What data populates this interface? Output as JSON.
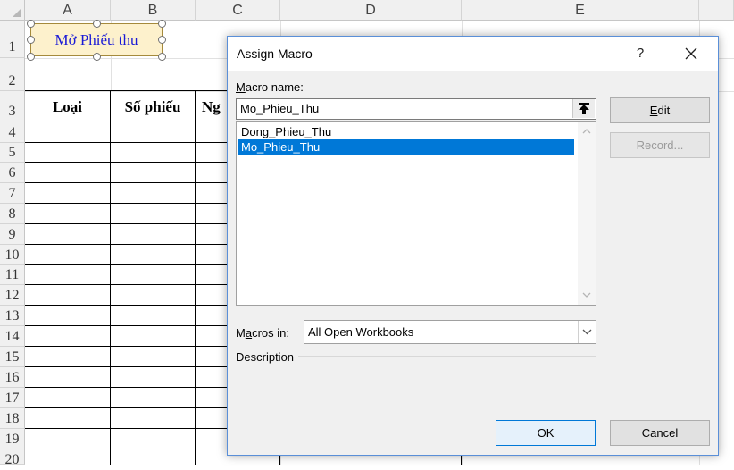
{
  "spreadsheet": {
    "columns": [
      "A",
      "B",
      "C",
      "D",
      "E"
    ],
    "rows": [
      "1",
      "2",
      "3",
      "4",
      "5",
      "6",
      "7",
      "8",
      "9",
      "10",
      "11",
      "12",
      "13",
      "14",
      "15",
      "16",
      "17",
      "18",
      "19",
      "20"
    ],
    "table_headers": [
      "Loại",
      "Số phiếu",
      "Ng"
    ],
    "shape_button_label": "Mở Phiếu thu"
  },
  "dialog": {
    "title": "Assign Macro",
    "help_label": "?",
    "macro_name_label": "Macro name:",
    "macro_name_value": "Mo_Phieu_Thu",
    "macros": [
      {
        "name": "Dong_Phieu_Thu",
        "selected": false
      },
      {
        "name": "Mo_Phieu_Thu",
        "selected": true
      }
    ],
    "edit_label": "Edit",
    "record_label": "Record...",
    "macros_in_label": "Macros in:",
    "macros_in_value": "All Open Workbooks",
    "description_label": "Description",
    "ok_label": "OK",
    "cancel_label": "Cancel"
  }
}
